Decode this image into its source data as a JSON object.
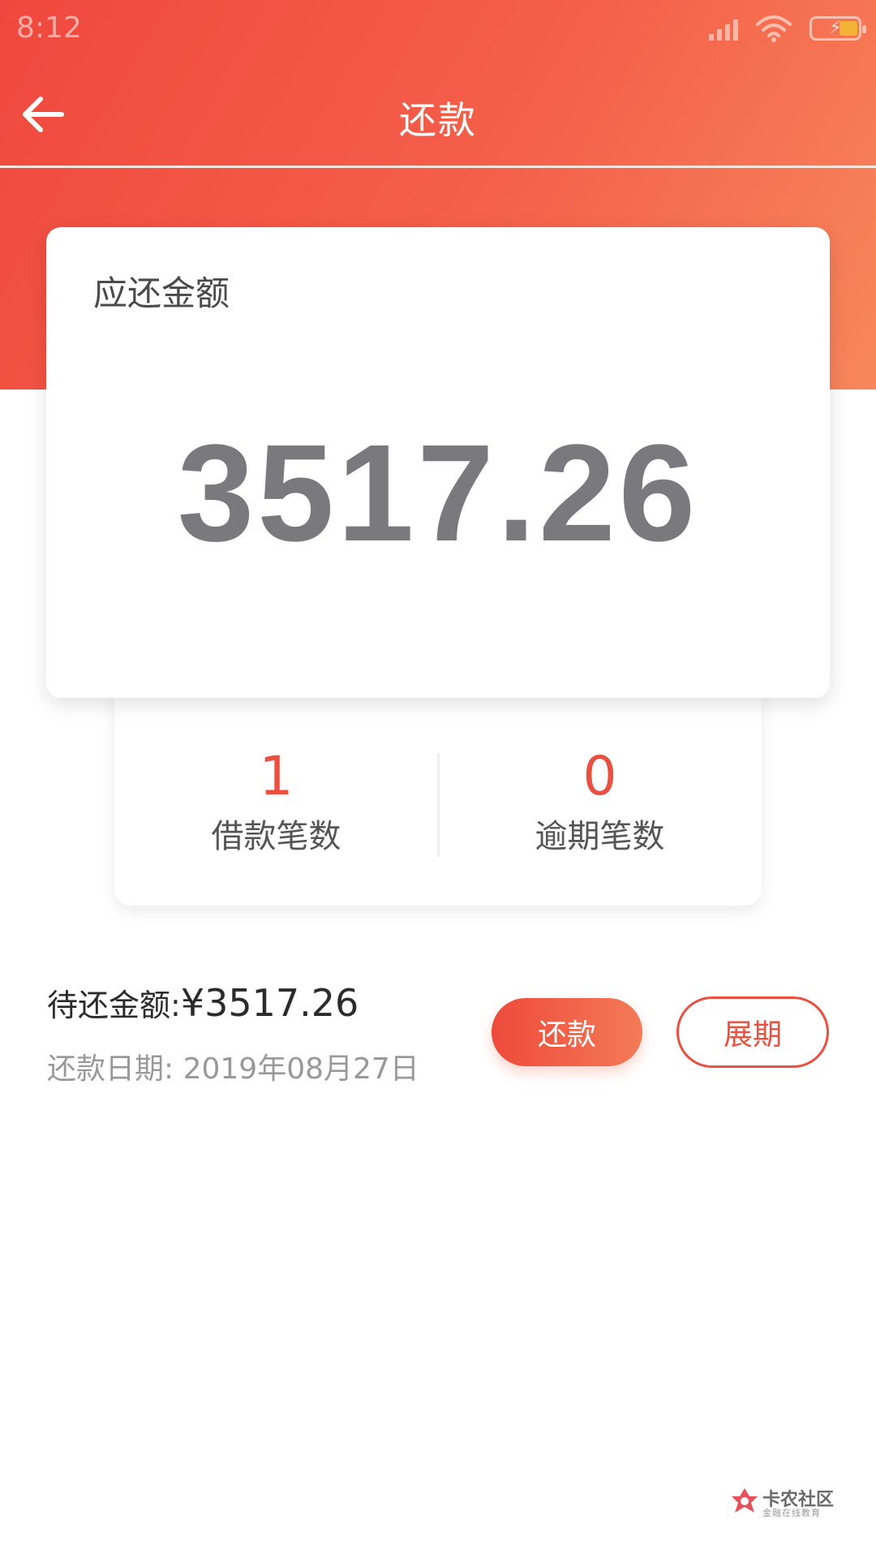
{
  "status_bar": {
    "time": "8:12",
    "icons": [
      "signal-icon",
      "wifi-icon",
      "battery-charging-icon"
    ]
  },
  "nav": {
    "title": "还款",
    "back_icon": "arrow-left-icon"
  },
  "amount_card": {
    "label": "应还金额",
    "value": "3517.26"
  },
  "stats": {
    "loan_count_value": "1",
    "loan_count_label": "借款笔数",
    "overdue_count_value": "0",
    "overdue_count_label": "逾期笔数"
  },
  "info": {
    "pending_label": "待还金额:",
    "pending_value": "¥3517.26",
    "date_text": "还款日期: 2019年08月27日"
  },
  "actions": {
    "repay_label": "还款",
    "extend_label": "展期"
  },
  "watermark": {
    "main": "卡农社区",
    "sub": "金融在线教育"
  },
  "colors": {
    "brand_red": "#ea4f3f",
    "header_start": "#f0483e",
    "header_end": "#f7875c",
    "amount_gray": "#7a7a7e"
  }
}
